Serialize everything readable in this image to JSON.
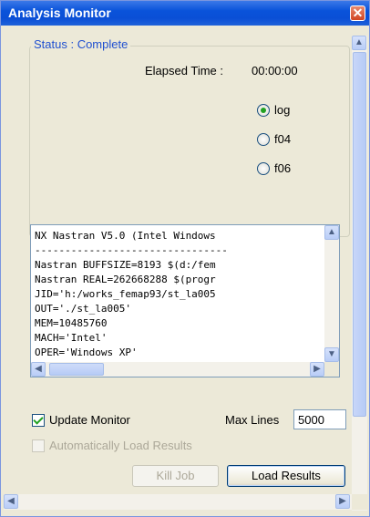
{
  "window": {
    "title": "Analysis Monitor",
    "close_icon": "close-icon"
  },
  "status": {
    "group_label": "Status : Complete",
    "elapsed_label": "Elapsed Time :",
    "elapsed_value": "00:00:00"
  },
  "radios": [
    {
      "label": "log",
      "selected": true
    },
    {
      "label": "f04",
      "selected": false
    },
    {
      "label": "f06",
      "selected": false
    }
  ],
  "log": {
    "lines": [
      "NX Nastran V5.0 (Intel Windows",
      "--------------------------------",
      "Nastran BUFFSIZE=8193 $(d:/fem",
      "Nastran REAL=262668288 $(progr",
      "JID='h:/works_femap93/st_la005",
      "OUT='./st_la005'",
      "MEM=10485760",
      "MACH='Intel'",
      "OPER='Windows XP'"
    ]
  },
  "options": {
    "update_monitor_label": "Update Monitor",
    "update_monitor_checked": true,
    "auto_load_label": "Automatically Load Results",
    "auto_load_checked": false,
    "max_lines_label": "Max Lines",
    "max_lines_value": "5000"
  },
  "buttons": {
    "kill_job": "Kill Job",
    "load_results": "Load Results"
  },
  "colors": {
    "title_bar": "#0a53da",
    "accent": "#21a121",
    "group_label": "#2050d0"
  }
}
